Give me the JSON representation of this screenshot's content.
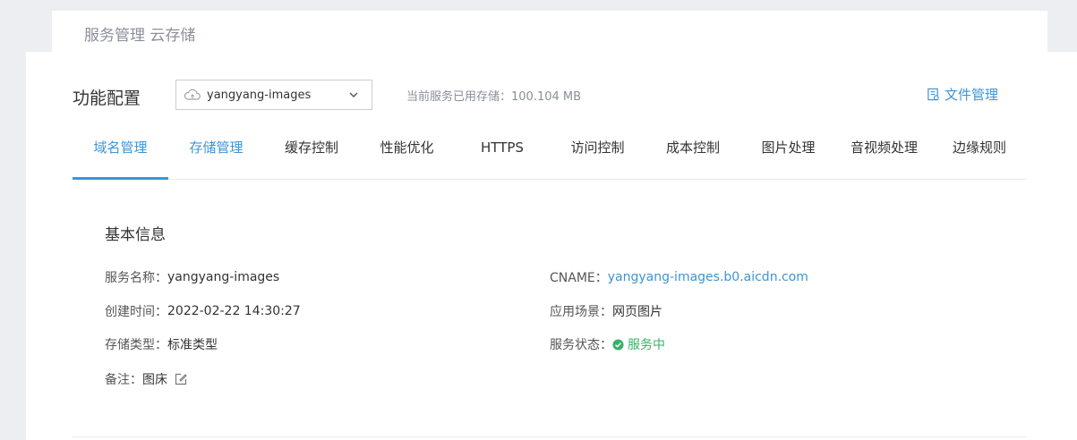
{
  "breadcrumb": "服务管理 云存储",
  "section_title": "功能配置",
  "service_select": {
    "value": "yangyang-images"
  },
  "usage": "当前服务已用存储：100.104 MB",
  "file_manager": "文件管理",
  "tabs": [
    {
      "label": "域名管理"
    },
    {
      "label": "存储管理"
    },
    {
      "label": "缓存控制"
    },
    {
      "label": "性能优化"
    },
    {
      "label": "HTTPS"
    },
    {
      "label": "访问控制"
    },
    {
      "label": "成本控制"
    },
    {
      "label": "图片处理"
    },
    {
      "label": "音视频处理"
    },
    {
      "label": "边缘规则"
    }
  ],
  "basic_info": {
    "title": "基本信息",
    "service_name_label": "服务名称：",
    "service_name": "yangyang-images",
    "created_label": "创建时间：",
    "created": "2022-02-22 14:30:27",
    "storage_type_label": "存储类型：",
    "storage_type": "标准类型",
    "note_label": "备注：",
    "note": "图床",
    "cname_label": "CNAME：",
    "cname": "yangyang-images.b0.aicdn.com",
    "scene_label": "应用场景：",
    "scene": "网页图片",
    "status_label": "服务状态：",
    "status": "服务中"
  },
  "colors": {
    "accent": "#3d95d6",
    "success": "#38b06a"
  }
}
